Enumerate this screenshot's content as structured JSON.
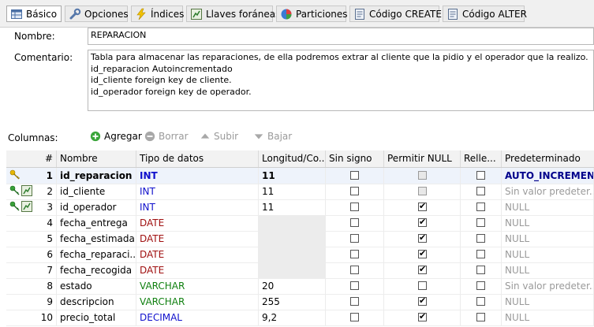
{
  "tabs": [
    {
      "label": "Básico",
      "icon": "table-icon",
      "active": true
    },
    {
      "label": "Opciones",
      "icon": "wrench-icon"
    },
    {
      "label": "Índices",
      "icon": "lightning-icon"
    },
    {
      "label": "Llaves foráneas",
      "icon": "relation-icon"
    },
    {
      "label": "Particiones",
      "icon": "pie-icon"
    },
    {
      "label": "Código CREATE",
      "icon": "code-icon"
    },
    {
      "label": "Código ALTER",
      "icon": "code-icon"
    }
  ],
  "form": {
    "name_label": "Nombre:",
    "name_value": "REPARACION",
    "comment_label": "Comentario:",
    "comment_lines": [
      "Tabla para almacenar las reparaciones, de ella podremos extrar al cliente que la pidio y el operador que la realizo.",
      "id_reparacion Autoincrementado",
      "id_cliente foreign key de cliente.",
      "id_operador foreign key de operador."
    ]
  },
  "columns_toolbar": {
    "label": "Columnas:",
    "add": "Agregar",
    "delete": "Borrar",
    "up": "Subir",
    "down": "Bajar"
  },
  "grid": {
    "headers": [
      "#",
      "Nombre",
      "Tipo de datos",
      "Longitud/Co...",
      "Sin signo",
      "Permitir NULL",
      "Relle...",
      "Predeterminado"
    ],
    "rows": [
      {
        "num": "1",
        "name": "id_reparacion",
        "type": "INT",
        "length": "11",
        "unsigned": false,
        "allow_null": false,
        "zerofill": false,
        "default": "AUTO_INCREMENT",
        "key": "primary"
      },
      {
        "num": "2",
        "name": "id_cliente",
        "type": "INT",
        "length": "11",
        "unsigned": false,
        "allow_null": false,
        "zerofill": false,
        "default": "Sin valor predeter...",
        "key": "foreign"
      },
      {
        "num": "3",
        "name": "id_operador",
        "type": "INT",
        "length": "11",
        "unsigned": false,
        "allow_null": true,
        "zerofill": false,
        "default": "NULL",
        "key": "foreign"
      },
      {
        "num": "4",
        "name": "fecha_entrega",
        "type": "DATE",
        "length": "",
        "unsigned": false,
        "allow_null": true,
        "zerofill": false,
        "default": "NULL",
        "key": ""
      },
      {
        "num": "5",
        "name": "fecha_estimada",
        "type": "DATE",
        "length": "",
        "unsigned": false,
        "allow_null": true,
        "zerofill": false,
        "default": "NULL",
        "key": ""
      },
      {
        "num": "6",
        "name": "fecha_reparaci...",
        "type": "DATE",
        "length": "",
        "unsigned": false,
        "allow_null": true,
        "zerofill": false,
        "default": "NULL",
        "key": ""
      },
      {
        "num": "7",
        "name": "fecha_recogida",
        "type": "DATE",
        "length": "",
        "unsigned": false,
        "allow_null": true,
        "zerofill": false,
        "default": "NULL",
        "key": ""
      },
      {
        "num": "8",
        "name": "estado",
        "type": "VARCHAR",
        "length": "20",
        "unsigned": false,
        "allow_null": false,
        "zerofill": false,
        "default": "Sin valor predeter...",
        "key": ""
      },
      {
        "num": "9",
        "name": "descripcion",
        "type": "VARCHAR",
        "length": "255",
        "unsigned": false,
        "allow_null": true,
        "zerofill": false,
        "default": "NULL",
        "key": ""
      },
      {
        "num": "10",
        "name": "precio_total",
        "type": "DECIMAL",
        "length": "9,2",
        "unsigned": false,
        "allow_null": true,
        "zerofill": false,
        "default": "NULL",
        "key": ""
      }
    ]
  }
}
